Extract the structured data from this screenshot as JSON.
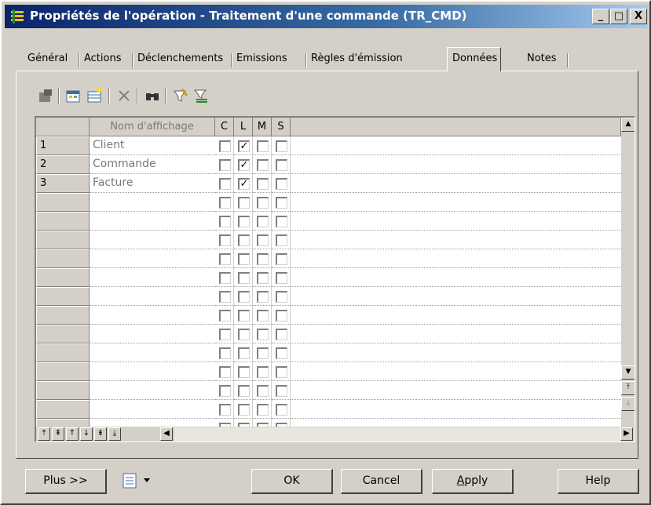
{
  "window": {
    "title": "Propriétés de l'opération - Traitement d'une commande (TR_CMD)",
    "minimize_label": "_",
    "maximize_label": "□",
    "close_label": "X"
  },
  "tabs": [
    {
      "label": "Général",
      "active": false
    },
    {
      "label": "Actions",
      "active": false
    },
    {
      "label": "Déclenchements",
      "active": false
    },
    {
      "label": "Emissions",
      "active": false
    },
    {
      "label": "Règles d'émission",
      "active": false
    },
    {
      "label": "Données",
      "active": true
    },
    {
      "label": "Notes",
      "active": false
    }
  ],
  "toolbar": {
    "icons": [
      "properties-icon",
      "add-rows-icon",
      "insert-row-icon",
      "delete-icon",
      "find-icon",
      "filter-icon",
      "customize-columns-icon"
    ]
  },
  "grid": {
    "columns": [
      "Nom d'affichage",
      "C",
      "L",
      "M",
      "S"
    ],
    "rows": [
      {
        "num": "1",
        "name": "Client",
        "c": false,
        "l": true,
        "m": false,
        "s": false
      },
      {
        "num": "2",
        "name": "Commande",
        "c": false,
        "l": true,
        "m": false,
        "s": false
      },
      {
        "num": "3",
        "name": "Facture",
        "c": false,
        "l": true,
        "m": false,
        "s": false
      }
    ],
    "empty_rows": 14
  },
  "buttons": {
    "plus": "Plus >>",
    "ok": "OK",
    "cancel": "Cancel",
    "apply_prefix": "",
    "apply_underline": "A",
    "apply_rest": "pply",
    "help": "Help"
  },
  "colors": {
    "title_start": "#0a246a",
    "title_end": "#a6caf0",
    "face": "#d4d0c8"
  }
}
